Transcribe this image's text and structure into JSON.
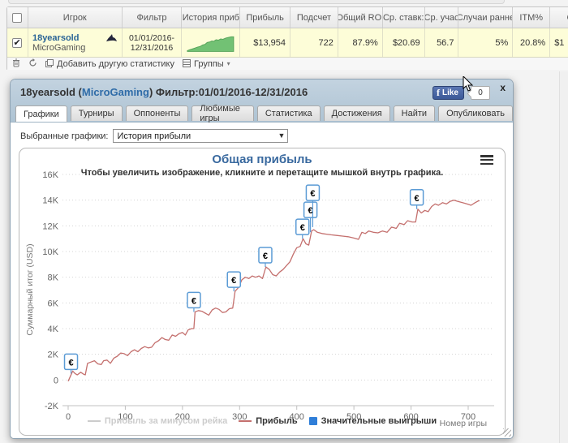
{
  "stats_table": {
    "headers": [
      "",
      "Игрок",
      "Фильтр",
      "История приб",
      "Прибыль",
      "Подсчет",
      "Общий ROI",
      "Ср. ставк:",
      "Ср. учас",
      "Случаи ранне",
      "ITM%",
      "Ср. п"
    ],
    "row": {
      "player": "18yearsold",
      "network": "MicroGaming",
      "filter_line1": "01/01/2016-",
      "filter_line2": "12/31/2016",
      "profit": "$13,954",
      "count": "722",
      "total_roi": "87.9%",
      "avg_stake": "$20.69",
      "avg_entrants": "56.7",
      "early_cases": "5%",
      "itm": "20.8%",
      "last_partial": "$1",
      "sparkline": [
        [
          0,
          0.95
        ],
        [
          0.05,
          0.9
        ],
        [
          0.1,
          0.86
        ],
        [
          0.16,
          0.8
        ],
        [
          0.22,
          0.74
        ],
        [
          0.28,
          0.7
        ],
        [
          0.33,
          0.62
        ],
        [
          0.38,
          0.58
        ],
        [
          0.43,
          0.47
        ],
        [
          0.48,
          0.44
        ],
        [
          0.53,
          0.38
        ],
        [
          0.57,
          0.4
        ],
        [
          0.62,
          0.31
        ],
        [
          0.67,
          0.33
        ],
        [
          0.72,
          0.26
        ],
        [
          0.77,
          0.28
        ],
        [
          0.83,
          0.21
        ],
        [
          0.89,
          0.17
        ],
        [
          0.95,
          0.13
        ],
        [
          1,
          0.13
        ]
      ]
    },
    "toolbar": {
      "add_label": "Добавить другую статистику",
      "groups_label": "Группы"
    }
  },
  "popup": {
    "title_prefix": "18yearsold (",
    "title_link": "MicroGaming",
    "title_suffix": ") Фильтр:01/01/2016-12/31/2016",
    "like_label": "Like",
    "like_count": "0",
    "close_label": "x",
    "tabs": [
      {
        "label": "Графики",
        "active": true
      },
      {
        "label": "Турниры",
        "active": false
      },
      {
        "label": "Оппоненты",
        "active": false
      },
      {
        "label": "Любимые игры",
        "active": false
      },
      {
        "label": "Статистика",
        "active": false
      },
      {
        "label": "Достижения",
        "active": false
      },
      {
        "label": "Найти",
        "active": false
      },
      {
        "label": "Опубликовать",
        "active": false
      }
    ],
    "selector_label": "Выбранные графики:",
    "selector_value": "История прибыли"
  },
  "chart_data": {
    "type": "line",
    "title": "Общая прибыль",
    "subtitle": "Чтобы увеличить изображение, кликните и перетащите мышкой внутрь графика.",
    "xlabel": "Номер игры",
    "ylabel": "Суммарный итог (USD)",
    "xlim": [
      0,
      740
    ],
    "ylim": [
      -2000,
      16000
    ],
    "grid": true,
    "legend_position": "bottom-center",
    "yticks": [
      {
        "v": -2000,
        "label": "-2K"
      },
      {
        "v": 0,
        "label": "0"
      },
      {
        "v": 2000,
        "label": "2K"
      },
      {
        "v": 4000,
        "label": "4K"
      },
      {
        "v": 6000,
        "label": "6K"
      },
      {
        "v": 8000,
        "label": "8K"
      },
      {
        "v": 10000,
        "label": "10K"
      },
      {
        "v": 12000,
        "label": "12K"
      },
      {
        "v": 14000,
        "label": "14K"
      },
      {
        "v": 16000,
        "label": "16K"
      }
    ],
    "xticks": [
      0,
      100,
      200,
      300,
      400,
      500,
      600,
      700
    ],
    "legend": [
      {
        "label": "Прибыль за минусом рейка",
        "color": "#cccccc",
        "marker": "line",
        "disabled": true
      },
      {
        "label": "Прибыль",
        "color": "#c4706e",
        "marker": "line",
        "disabled": false
      },
      {
        "label": "Значительные выигрыши",
        "color": "#2f7ed8",
        "marker": "square",
        "disabled": false
      }
    ],
    "series": [
      {
        "name": "Прибыль",
        "color": "#c4706e",
        "points": [
          [
            0,
            -100
          ],
          [
            3,
            200
          ],
          [
            8,
            700
          ],
          [
            12,
            500
          ],
          [
            16,
            400
          ],
          [
            22,
            600
          ],
          [
            27,
            450
          ],
          [
            30,
            400
          ],
          [
            34,
            1300
          ],
          [
            40,
            1400
          ],
          [
            46,
            1500
          ],
          [
            52,
            1250
          ],
          [
            58,
            1200
          ],
          [
            62,
            1500
          ],
          [
            68,
            1550
          ],
          [
            74,
            1300
          ],
          [
            80,
            1700
          ],
          [
            86,
            1850
          ],
          [
            92,
            2100
          ],
          [
            98,
            2050
          ],
          [
            104,
            1900
          ],
          [
            110,
            2200
          ],
          [
            116,
            2350
          ],
          [
            122,
            2200
          ],
          [
            128,
            2450
          ],
          [
            134,
            2600
          ],
          [
            140,
            2500
          ],
          [
            146,
            2550
          ],
          [
            152,
            2900
          ],
          [
            158,
            3050
          ],
          [
            164,
            3300
          ],
          [
            170,
            3150
          ],
          [
            176,
            3100
          ],
          [
            182,
            3500
          ],
          [
            188,
            3400
          ],
          [
            194,
            3600
          ],
          [
            200,
            3700
          ],
          [
            205,
            3500
          ],
          [
            210,
            3900
          ],
          [
            216,
            4000
          ],
          [
            220,
            4000
          ],
          [
            222,
            5300
          ],
          [
            228,
            5400
          ],
          [
            234,
            5350
          ],
          [
            240,
            5200
          ],
          [
            246,
            5050
          ],
          [
            252,
            5450
          ],
          [
            258,
            5600
          ],
          [
            264,
            5500
          ],
          [
            270,
            5250
          ],
          [
            276,
            5300
          ],
          [
            282,
            5550
          ],
          [
            288,
            5600
          ],
          [
            292,
            6900
          ],
          [
            298,
            7200
          ],
          [
            304,
            7800
          ],
          [
            310,
            8000
          ],
          [
            316,
            7900
          ],
          [
            322,
            8100
          ],
          [
            328,
            8000
          ],
          [
            334,
            8100
          ],
          [
            340,
            7900
          ],
          [
            346,
            8800
          ],
          [
            352,
            8600
          ],
          [
            358,
            8200
          ],
          [
            364,
            8100
          ],
          [
            370,
            8400
          ],
          [
            376,
            8600
          ],
          [
            382,
            8900
          ],
          [
            388,
            9200
          ],
          [
            394,
            9800
          ],
          [
            400,
            10300
          ],
          [
            406,
            10400
          ],
          [
            411,
            11000
          ],
          [
            416,
            10600
          ],
          [
            421,
            10500
          ],
          [
            426,
            11600
          ],
          [
            430,
            11700
          ],
          [
            436,
            11500
          ],
          [
            444,
            11400
          ],
          [
            452,
            11350
          ],
          [
            460,
            11300
          ],
          [
            470,
            11250
          ],
          [
            480,
            11200
          ],
          [
            490,
            11150
          ],
          [
            500,
            11050
          ],
          [
            508,
            10950
          ],
          [
            514,
            11500
          ],
          [
            520,
            11400
          ],
          [
            526,
            11600
          ],
          [
            534,
            11500
          ],
          [
            542,
            11450
          ],
          [
            550,
            11600
          ],
          [
            558,
            11500
          ],
          [
            566,
            11900
          ],
          [
            574,
            11800
          ],
          [
            580,
            12200
          ],
          [
            588,
            12100
          ],
          [
            594,
            12400
          ],
          [
            602,
            12300
          ],
          [
            608,
            12300
          ],
          [
            612,
            13300
          ],
          [
            618,
            13000
          ],
          [
            624,
            13200
          ],
          [
            630,
            13100
          ],
          [
            636,
            13500
          ],
          [
            642,
            13700
          ],
          [
            648,
            13600
          ],
          [
            655,
            13800
          ],
          [
            662,
            13700
          ],
          [
            668,
            13900
          ],
          [
            675,
            14000
          ],
          [
            682,
            13900
          ],
          [
            690,
            13800
          ],
          [
            698,
            13700
          ],
          [
            705,
            13600
          ],
          [
            712,
            13800
          ],
          [
            718,
            13950
          ],
          [
            720,
            13950
          ]
        ]
      }
    ],
    "flags": {
      "symbol": "€",
      "points": [
        [
          5,
          500
        ],
        [
          220,
          5300
        ],
        [
          290,
          6900
        ],
        [
          345,
          8800
        ],
        [
          410,
          11000
        ],
        [
          424,
          11500
        ],
        [
          428,
          11900
        ],
        [
          610,
          13300
        ]
      ]
    }
  }
}
